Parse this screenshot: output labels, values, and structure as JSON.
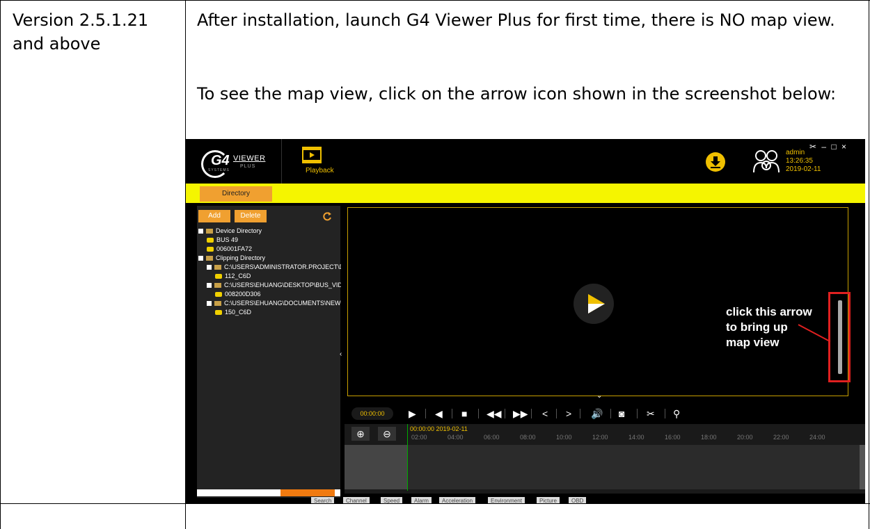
{
  "doc": {
    "version_line1": "Version 2.5.1.21",
    "version_line2": "and above",
    "para1": "After installation, launch G4 Viewer Plus for first time, there is NO map view.",
    "para2": "To see the map view, click on the arrow icon shown in the screenshot below:"
  },
  "app": {
    "logo": {
      "g4": "G4",
      "viewer": "VIEWER",
      "plus": "PLUS",
      "systems": "SYSTEMS"
    },
    "playback_label": "Playback",
    "user": {
      "name": "admin",
      "time": "13:26:35",
      "date": "2019-02-11"
    },
    "directory_tab": "Directory",
    "add_label": "Add",
    "delete_label": "Delete",
    "tree": [
      {
        "label": "Device Directory",
        "kind": "folder",
        "level": 0
      },
      {
        "label": "BUS 49",
        "kind": "bus",
        "level": 1
      },
      {
        "label": "006001FA72",
        "kind": "bus",
        "level": 1
      },
      {
        "label": "Clipping Directory",
        "kind": "folder",
        "level": 0
      },
      {
        "label": "C:\\USERS\\ADMINISTRATOR.PROJECT\\DI",
        "kind": "folder",
        "level": 1
      },
      {
        "label": "112_C6D",
        "kind": "bus",
        "level": 2
      },
      {
        "label": "C:\\USERS\\EHUANG\\DESKTOP\\BUS_VIDI",
        "kind": "folder",
        "level": 1
      },
      {
        "label": "008200D306",
        "kind": "bus",
        "level": 2
      },
      {
        "label": "C:\\USERS\\EHUANG\\DOCUMENTS\\NEW I",
        "kind": "folder",
        "level": 1
      },
      {
        "label": "150_C6D",
        "kind": "bus",
        "level": 2
      }
    ],
    "time_display": "00:00:00",
    "timeline_date": "00:00:00 2019-02-11",
    "ticks": [
      "02:00",
      "04:00",
      "06:00",
      "08:00",
      "10:00",
      "12:00",
      "14:00",
      "16:00",
      "18:00",
      "20:00",
      "22:00",
      "24:00"
    ],
    "bottom_tabs": [
      "Search",
      "Channel",
      "Speed",
      "Alarm",
      "Acceleration",
      "Environment",
      "Picture",
      "OBD"
    ],
    "annotation": "click this arrow\nto bring up\nmap view",
    "colors": {
      "accent": "#f0a030",
      "strip": "#f5f500",
      "gold": "#f0c000",
      "annotation": "#e02020"
    }
  }
}
